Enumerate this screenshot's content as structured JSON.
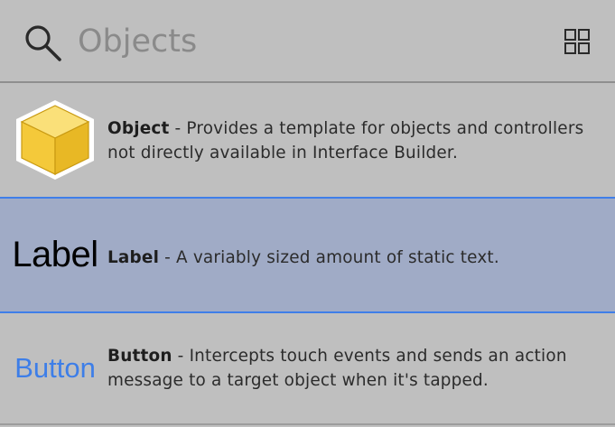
{
  "search": {
    "placeholder": "Objects",
    "value": ""
  },
  "view_toggle": {
    "icon": "grid-view-icon"
  },
  "items": [
    {
      "name": "Object",
      "separator": " - ",
      "description": "Provides a template for objects and controllers not directly available in Interface Builder.",
      "thumbnail_icon": "cube-icon",
      "selected": false
    },
    {
      "name": "Label",
      "separator": " - ",
      "description": "A variably sized amount of static text.",
      "thumbnail_text": "Label",
      "selected": true
    },
    {
      "name": "Button",
      "separator": " - ",
      "description": "Intercepts touch events and sends an action message to a target object when it's tapped.",
      "thumbnail_text": "Button",
      "selected": false
    }
  ],
  "colors": {
    "background": "#bfbfbf",
    "selection": "#a0abc6",
    "selection_border": "#3f7ee8",
    "button_blue": "#3d7ee8",
    "cube_fill": "#f8d046"
  }
}
